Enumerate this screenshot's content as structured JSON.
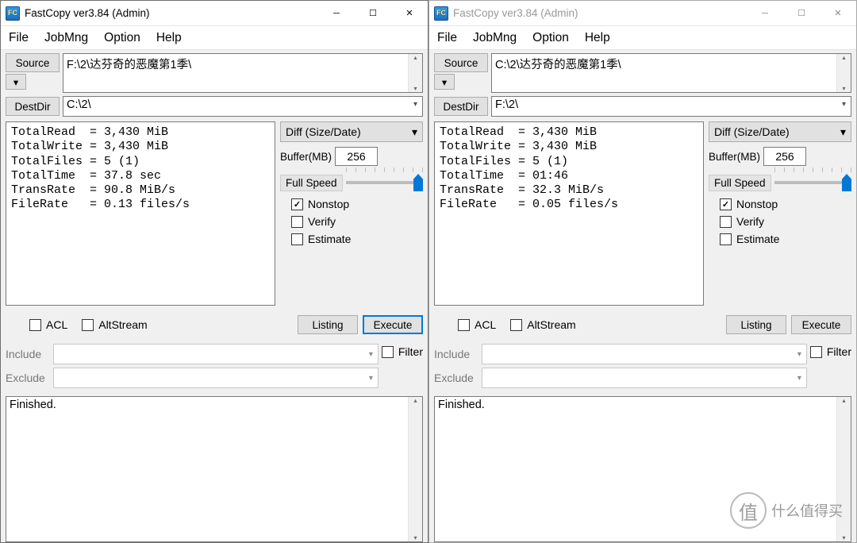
{
  "watermark": "什么值得买",
  "left": {
    "title": "FastCopy ver3.84 (Admin)",
    "app_icon_text": "FC",
    "menu": {
      "file": "File",
      "jobmng": "JobMng",
      "option": "Option",
      "help": "Help"
    },
    "source_btn": "Source",
    "source_path": "F:\\2\\达芬奇的恶魔第1季\\",
    "dest_btn": "DestDir",
    "dest_path": "C:\\2\\",
    "stats": "TotalRead  = 3,430 MiB\nTotalWrite = 3,430 MiB\nTotalFiles = 5 (1)\nTotalTime  = 37.8 sec\nTransRate  = 90.8 MiB/s\nFileRate   = 0.13 files/s",
    "mode": "Diff (Size/Date)",
    "buffer_lbl": "Buffer(MB)",
    "buffer_val": "256",
    "speed_lbl": "Full Speed",
    "chk_nonstop": "Nonstop",
    "chk_verify": "Verify",
    "chk_estimate": "Estimate",
    "chk_acl": "ACL",
    "chk_altstream": "AltStream",
    "listing_btn": "Listing",
    "execute_btn": "Execute",
    "include_lbl": "Include",
    "exclude_lbl": "Exclude",
    "filter_lbl": "Filter",
    "log": "Finished."
  },
  "right": {
    "title": "FastCopy ver3.84 (Admin)",
    "app_icon_text": "FC",
    "menu": {
      "file": "File",
      "jobmng": "JobMng",
      "option": "Option",
      "help": "Help"
    },
    "source_btn": "Source",
    "source_path": "C:\\2\\达芬奇的恶魔第1季\\",
    "dest_btn": "DestDir",
    "dest_path": "F:\\2\\",
    "stats": "TotalRead  = 3,430 MiB\nTotalWrite = 3,430 MiB\nTotalFiles = 5 (1)\nTotalTime  = 01:46\nTransRate  = 32.3 MiB/s\nFileRate   = 0.05 files/s",
    "mode": "Diff (Size/Date)",
    "buffer_lbl": "Buffer(MB)",
    "buffer_val": "256",
    "speed_lbl": "Full Speed",
    "chk_nonstop": "Nonstop",
    "chk_verify": "Verify",
    "chk_estimate": "Estimate",
    "chk_acl": "ACL",
    "chk_altstream": "AltStream",
    "listing_btn": "Listing",
    "execute_btn": "Execute",
    "include_lbl": "Include",
    "exclude_lbl": "Exclude",
    "filter_lbl": "Filter",
    "log": "Finished."
  }
}
